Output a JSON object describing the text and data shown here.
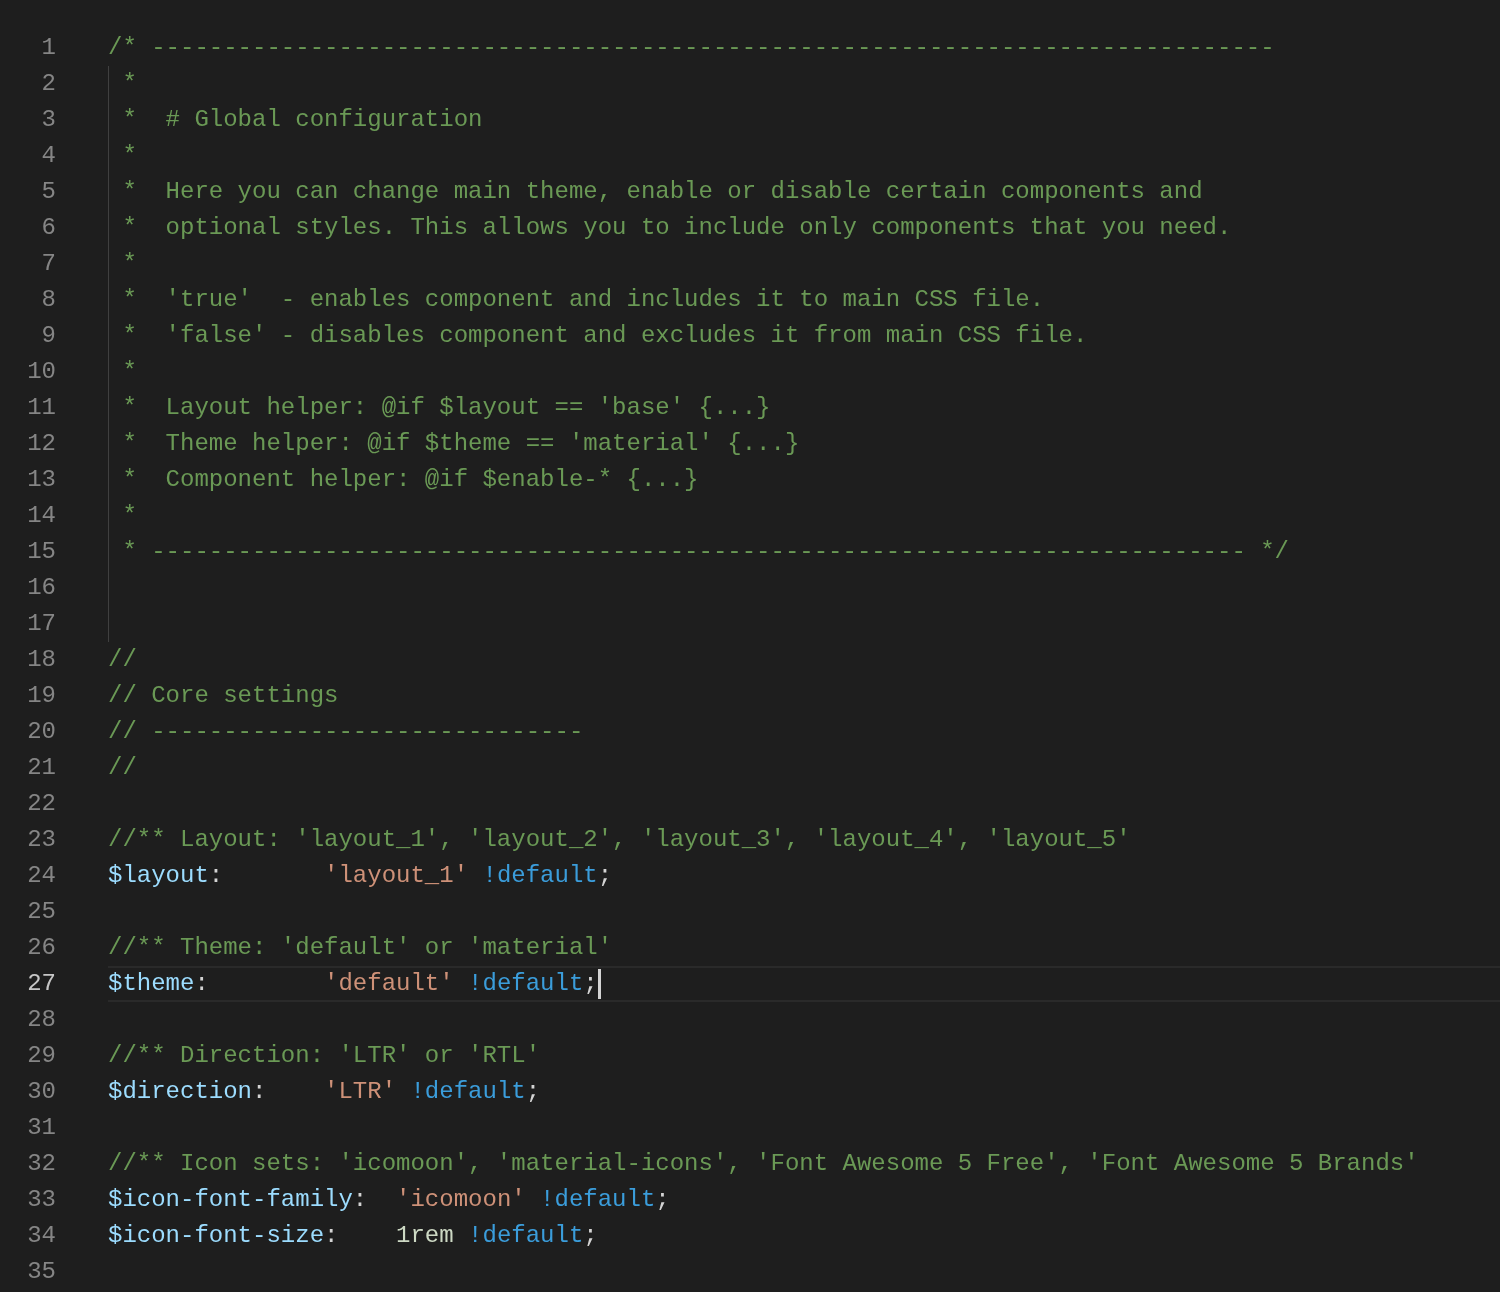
{
  "editor": {
    "lines": [
      {
        "number": "1",
        "current": false,
        "indent_guide": false,
        "tokens": [
          {
            "kind": "comment",
            "text": "/* ------------------------------------------------------------------------------"
          }
        ]
      },
      {
        "number": "2",
        "current": false,
        "indent_guide": true,
        "tokens": [
          {
            "kind": "comment",
            "text": " *"
          }
        ]
      },
      {
        "number": "3",
        "current": false,
        "indent_guide": true,
        "tokens": [
          {
            "kind": "comment",
            "text": " *  # Global configuration"
          }
        ]
      },
      {
        "number": "4",
        "current": false,
        "indent_guide": true,
        "tokens": [
          {
            "kind": "comment",
            "text": " *"
          }
        ]
      },
      {
        "number": "5",
        "current": false,
        "indent_guide": true,
        "tokens": [
          {
            "kind": "comment",
            "text": " *  Here you can change main theme, enable or disable certain components and"
          }
        ]
      },
      {
        "number": "6",
        "current": false,
        "indent_guide": true,
        "tokens": [
          {
            "kind": "comment",
            "text": " *  optional styles. This allows you to include only components that you need."
          }
        ]
      },
      {
        "number": "7",
        "current": false,
        "indent_guide": true,
        "tokens": [
          {
            "kind": "comment",
            "text": " *"
          }
        ]
      },
      {
        "number": "8",
        "current": false,
        "indent_guide": true,
        "tokens": [
          {
            "kind": "comment",
            "text": " *  'true'  - enables component and includes it to main CSS file."
          }
        ]
      },
      {
        "number": "9",
        "current": false,
        "indent_guide": true,
        "tokens": [
          {
            "kind": "comment",
            "text": " *  'false' - disables component and excludes it from main CSS file."
          }
        ]
      },
      {
        "number": "10",
        "current": false,
        "indent_guide": true,
        "tokens": [
          {
            "kind": "comment",
            "text": " *"
          }
        ]
      },
      {
        "number": "11",
        "current": false,
        "indent_guide": true,
        "tokens": [
          {
            "kind": "comment",
            "text": " *  Layout helper: @if $layout == 'base' {...}"
          }
        ]
      },
      {
        "number": "12",
        "current": false,
        "indent_guide": true,
        "tokens": [
          {
            "kind": "comment",
            "text": " *  Theme helper: @if $theme == 'material' {...}"
          }
        ]
      },
      {
        "number": "13",
        "current": false,
        "indent_guide": true,
        "tokens": [
          {
            "kind": "comment",
            "text": " *  Component helper: @if $enable-* {...}"
          }
        ]
      },
      {
        "number": "14",
        "current": false,
        "indent_guide": true,
        "tokens": [
          {
            "kind": "comment",
            "text": " *"
          }
        ]
      },
      {
        "number": "15",
        "current": false,
        "indent_guide": true,
        "tokens": [
          {
            "kind": "comment",
            "text": " * ---------------------------------------------------------------------------- */"
          }
        ]
      },
      {
        "number": "16",
        "current": false,
        "indent_guide": true
      },
      {
        "number": "17",
        "current": false,
        "indent_guide": true
      },
      {
        "number": "18",
        "current": false,
        "indent_guide": false,
        "tokens": [
          {
            "kind": "comment",
            "text": "//"
          }
        ]
      },
      {
        "number": "19",
        "current": false,
        "indent_guide": false,
        "tokens": [
          {
            "kind": "comment",
            "text": "// Core settings"
          }
        ]
      },
      {
        "number": "20",
        "current": false,
        "indent_guide": false,
        "tokens": [
          {
            "kind": "comment",
            "text": "// ------------------------------"
          }
        ]
      },
      {
        "number": "21",
        "current": false,
        "indent_guide": false,
        "tokens": [
          {
            "kind": "comment",
            "text": "//"
          }
        ]
      },
      {
        "number": "22",
        "current": false,
        "indent_guide": false
      },
      {
        "number": "23",
        "current": false,
        "indent_guide": false,
        "tokens": [
          {
            "kind": "comment",
            "text": "//** Layout: 'layout_1', 'layout_2', 'layout_3', 'layout_4', 'layout_5'"
          }
        ]
      },
      {
        "number": "24",
        "current": false,
        "indent_guide": false,
        "tokens": [
          {
            "kind": "variable",
            "text": "$layout"
          },
          {
            "kind": "plain",
            "text": ":       "
          },
          {
            "kind": "string",
            "text": "'layout_1'"
          },
          {
            "kind": "keyword",
            "text": " !default"
          },
          {
            "kind": "plain",
            "text": ";"
          }
        ]
      },
      {
        "number": "25",
        "current": false,
        "indent_guide": false
      },
      {
        "number": "26",
        "current": false,
        "indent_guide": false,
        "tokens": [
          {
            "kind": "comment",
            "text": "//** Theme: 'default' or 'material'"
          }
        ]
      },
      {
        "number": "27",
        "current": true,
        "indent_guide": false,
        "tokens": [
          {
            "kind": "variable",
            "text": "$theme"
          },
          {
            "kind": "plain",
            "text": ":        "
          },
          {
            "kind": "string",
            "text": "'default'"
          },
          {
            "kind": "keyword",
            "text": " !default"
          },
          {
            "kind": "plain",
            "text": ";"
          }
        ]
      },
      {
        "number": "28",
        "current": false,
        "indent_guide": false
      },
      {
        "number": "29",
        "current": false,
        "indent_guide": false,
        "tokens": [
          {
            "kind": "comment",
            "text": "//** Direction: 'LTR' or 'RTL'"
          }
        ]
      },
      {
        "number": "30",
        "current": false,
        "indent_guide": false,
        "tokens": [
          {
            "kind": "variable",
            "text": "$direction"
          },
          {
            "kind": "plain",
            "text": ":    "
          },
          {
            "kind": "string",
            "text": "'LTR'"
          },
          {
            "kind": "keyword",
            "text": " !default"
          },
          {
            "kind": "plain",
            "text": ";"
          }
        ]
      },
      {
        "number": "31",
        "current": false,
        "indent_guide": false
      },
      {
        "number": "32",
        "current": false,
        "indent_guide": false,
        "tokens": [
          {
            "kind": "comment",
            "text": "//** Icon sets: 'icomoon', 'material-icons', 'Font Awesome 5 Free', 'Font Awesome 5 Brands'"
          }
        ]
      },
      {
        "number": "33",
        "current": false,
        "indent_guide": false,
        "tokens": [
          {
            "kind": "variable",
            "text": "$icon-font-family"
          },
          {
            "kind": "plain",
            "text": ":  "
          },
          {
            "kind": "string",
            "text": "'icomoon'"
          },
          {
            "kind": "keyword",
            "text": " !default"
          },
          {
            "kind": "plain",
            "text": ";"
          }
        ]
      },
      {
        "number": "34",
        "current": false,
        "indent_guide": false,
        "tokens": [
          {
            "kind": "variable",
            "text": "$icon-font-size"
          },
          {
            "kind": "plain",
            "text": ":    "
          },
          {
            "kind": "number",
            "text": "1rem"
          },
          {
            "kind": "keyword",
            "text": " !default"
          },
          {
            "kind": "plain",
            "text": ";"
          }
        ]
      },
      {
        "number": "35",
        "current": false,
        "indent_guide": false
      }
    ]
  }
}
